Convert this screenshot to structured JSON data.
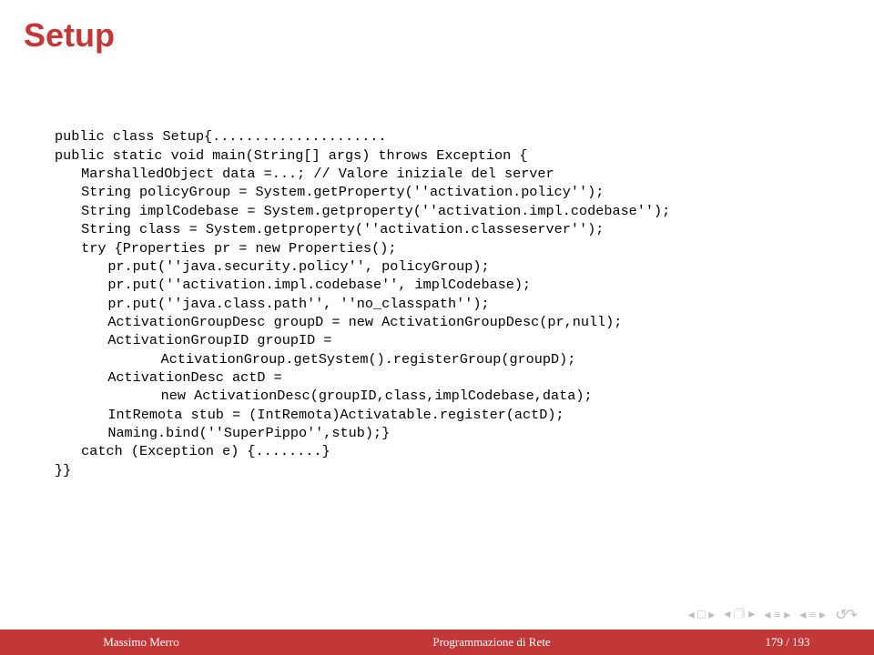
{
  "title": "Setup",
  "code": {
    "l1": "public class Setup{.....................",
    "l2": "public static void main(String[] args) throws Exception {",
    "l3": "MarshalledObject data =...; // Valore iniziale del server",
    "l4": "String policyGroup = System.getProperty(''activation.policy'');",
    "l5": "String implCodebase = System.getproperty(''activation.impl.codebase'');",
    "l6": "String class = System.getproperty(''activation.classeserver'');",
    "l7": "try {Properties pr = new Properties();",
    "l8": "pr.put(''java.security.policy'', policyGroup);",
    "l9": "pr.put(''activation.impl.codebase'', implCodebase);",
    "l10": "pr.put(''java.class.path'', ''no_classpath'');",
    "l11": "ActivationGroupDesc groupD = new ActivationGroupDesc(pr,null);",
    "l12": "ActivationGroupID groupID =",
    "l13": "ActivationGroup.getSystem().registerGroup(groupD);",
    "l14": "ActivationDesc actD =",
    "l15": "new ActivationDesc(groupID,class,implCodebase,data);",
    "l16": "IntRemota stub = (IntRemota)Activatable.register(actD);",
    "l17": "Naming.bind(''SuperPippo'',stub);}",
    "l18": "catch (Exception e) {........}",
    "l19": "}}"
  },
  "footer": {
    "author": "Massimo Merro",
    "center": "Programmazione di Rete",
    "page": "179 / 193"
  },
  "nav": {
    "first": "◂ □ ▸",
    "prevsec": "◂ 🗇 ▸",
    "prev": "◂ ≡ ▸",
    "next": "◂ ≡ ▸",
    "loop": "↺↷"
  }
}
